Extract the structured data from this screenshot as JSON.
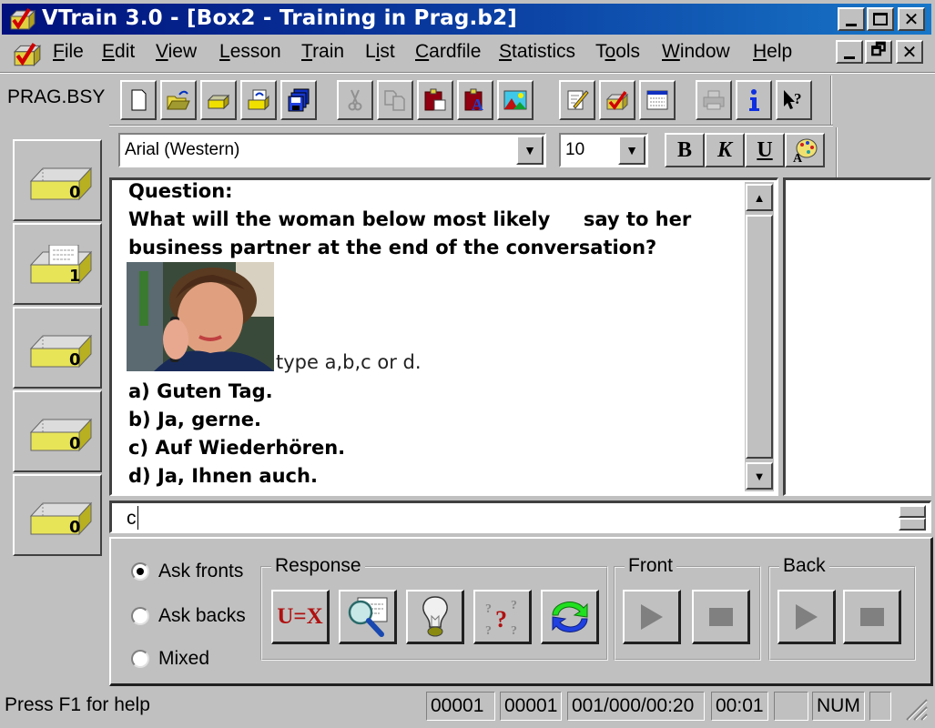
{
  "window": {
    "title": "VTrain 3.0 - [Box2 - Training in Prag.b2]",
    "app_icon": "vtrain-box-check-icon",
    "controls": [
      "minimize",
      "maximize",
      "close"
    ],
    "mdi_controls": [
      "minimize",
      "restore",
      "close"
    ]
  },
  "menu": {
    "items": [
      {
        "label": "File",
        "accel": "F"
      },
      {
        "label": "Edit",
        "accel": "E"
      },
      {
        "label": "View",
        "accel": "V"
      },
      {
        "label": "Lesson",
        "accel": "L"
      },
      {
        "label": "Train",
        "accel": "T"
      },
      {
        "label": "List",
        "accel": "i"
      },
      {
        "label": "Cardfile",
        "accel": "C"
      },
      {
        "label": "Statistics",
        "accel": "S"
      },
      {
        "label": "Tools",
        "accel": "o"
      },
      {
        "label": "Window",
        "accel": "W"
      },
      {
        "label": "Help",
        "accel": "H"
      }
    ]
  },
  "toolbar": {
    "filename": "PRAG.BSY",
    "buttons": [
      {
        "icon": "new-file-icon"
      },
      {
        "icon": "open-folder-icon"
      },
      {
        "icon": "open-box-icon"
      },
      {
        "icon": "reload-box-icon"
      },
      {
        "icon": "save-all-icon"
      },
      {
        "icon": "cut-icon",
        "disabled": true
      },
      {
        "icon": "copy-icon",
        "disabled": true
      },
      {
        "icon": "paste-icon"
      },
      {
        "icon": "paste-format-icon"
      },
      {
        "icon": "insert-image-icon"
      },
      {
        "icon": "edit-card-icon"
      },
      {
        "icon": "train-box-icon"
      },
      {
        "icon": "list-icon"
      },
      {
        "icon": "print-icon",
        "disabled": true
      },
      {
        "icon": "info-icon"
      },
      {
        "icon": "context-help-icon"
      }
    ]
  },
  "format_bar": {
    "font": "Arial (Western)",
    "size": "10",
    "bold_label": "B",
    "italic_label": "K",
    "underline_label": "U",
    "color_icon": "color-palette-icon"
  },
  "boxes": [
    {
      "count": "0",
      "has_cards": false
    },
    {
      "count": "1",
      "has_cards": true
    },
    {
      "count": "0",
      "has_cards": false
    },
    {
      "count": "0",
      "has_cards": false
    },
    {
      "count": "0",
      "has_cards": false
    }
  ],
  "question": {
    "heading": "Question:",
    "line1": "What will the woman below most likely     say to her",
    "line2": "business partner at the end of the conversation?",
    "image_alt": "woman-on-phone-photo",
    "instruction": "type a,b,c or d.",
    "options": [
      "a) Guten Tag.",
      "b) Ja, gerne.",
      "c) Auf Wiederhören.",
      "d) Ja, Ihnen auch."
    ]
  },
  "answer": {
    "value": "c"
  },
  "ask_mode": {
    "options": [
      "Ask fronts",
      "Ask backs",
      "Mixed"
    ],
    "selected": "Ask fronts"
  },
  "response": {
    "label": "Response",
    "buttons": [
      {
        "icon": "mark-equal-icon",
        "text": "U=X"
      },
      {
        "icon": "show-answer-icon"
      },
      {
        "icon": "hint-icon"
      },
      {
        "icon": "dont-know-icon"
      },
      {
        "icon": "repeat-icon"
      }
    ]
  },
  "front": {
    "label": "Front",
    "play_icon": "play-icon",
    "stop_icon": "stop-icon"
  },
  "back": {
    "label": "Back",
    "play_icon": "play-icon",
    "stop_icon": "stop-icon"
  },
  "status": {
    "help": "Press F1 for help",
    "cells": [
      "00001",
      "00001",
      "001/000/00:20",
      "00:01",
      "",
      "NUM",
      ""
    ]
  }
}
